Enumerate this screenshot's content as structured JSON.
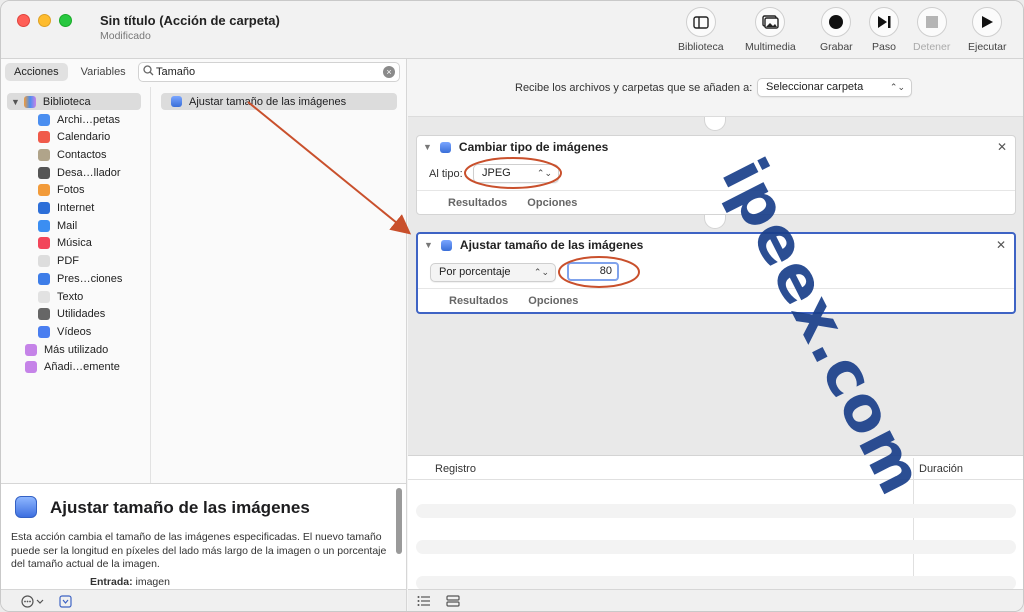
{
  "window": {
    "title": "Sin título (Acción de carpeta)",
    "subtitle": "Modificado"
  },
  "toolbar": {
    "library": "Biblioteca",
    "media": "Multimedia",
    "record": "Grabar",
    "step": "Paso",
    "stop": "Detener",
    "run": "Ejecutar"
  },
  "left": {
    "tabs": [
      "Acciones",
      "Variables"
    ],
    "search_value": "Tamaño",
    "library_root": "Biblioteca",
    "library_items": [
      {
        "label": "Archi…petas",
        "color": "#4a8ef0"
      },
      {
        "label": "Calendario",
        "color": "#f05a4a"
      },
      {
        "label": "Contactos",
        "color": "#b0a48a"
      },
      {
        "label": "Desa…llador",
        "color": "#555555"
      },
      {
        "label": "Fotos",
        "color": "#f29b3a"
      },
      {
        "label": "Internet",
        "color": "#2d6fd8"
      },
      {
        "label": "Mail",
        "color": "#3b8ef2"
      },
      {
        "label": "Música",
        "color": "#f2455a"
      },
      {
        "label": "PDF",
        "color": "#dddddd"
      },
      {
        "label": "Pres…ciones",
        "color": "#3d7de8"
      },
      {
        "label": "Texto",
        "color": "#e2e2e2"
      },
      {
        "label": "Utilidades",
        "color": "#666666"
      },
      {
        "label": "Vídeos",
        "color": "#4a7ef0"
      },
      {
        "label": "Más utilizado",
        "color": "#c583e8"
      },
      {
        "label": "Añadi…emente",
        "color": "#c583e8"
      }
    ],
    "result_action": "Ajustar tamaño de las imágenes"
  },
  "description": {
    "title": "Ajustar tamaño de las imágenes",
    "text": "Esta acción cambia el tamaño de las imágenes especificadas. El nuevo tamaño puede ser la longitud en píxeles del lado más largo de la imagen o un porcentaje del tamaño actual de la imagen.",
    "input_label": "Entrada:",
    "input_value": "imagen"
  },
  "workflow": {
    "receives_label": "Recibe los archivos y carpetas que se añaden a:",
    "receives_value": "Seleccionar carpeta",
    "action1": {
      "title": "Cambiar tipo de imágenes",
      "field_label": "Al tipo:",
      "field_value": "JPEG",
      "results": "Resultados",
      "options": "Opciones"
    },
    "action2": {
      "title": "Ajustar tamaño de las imágenes",
      "mode_value": "Por porcentaje",
      "amount": "80",
      "results": "Resultados",
      "options": "Opciones"
    }
  },
  "log": {
    "col1": "Registro",
    "col2": "Duración"
  },
  "watermark": "ipeex.com",
  "colors": {
    "annotation": "#c9502c",
    "selection": "#3e63c4"
  }
}
